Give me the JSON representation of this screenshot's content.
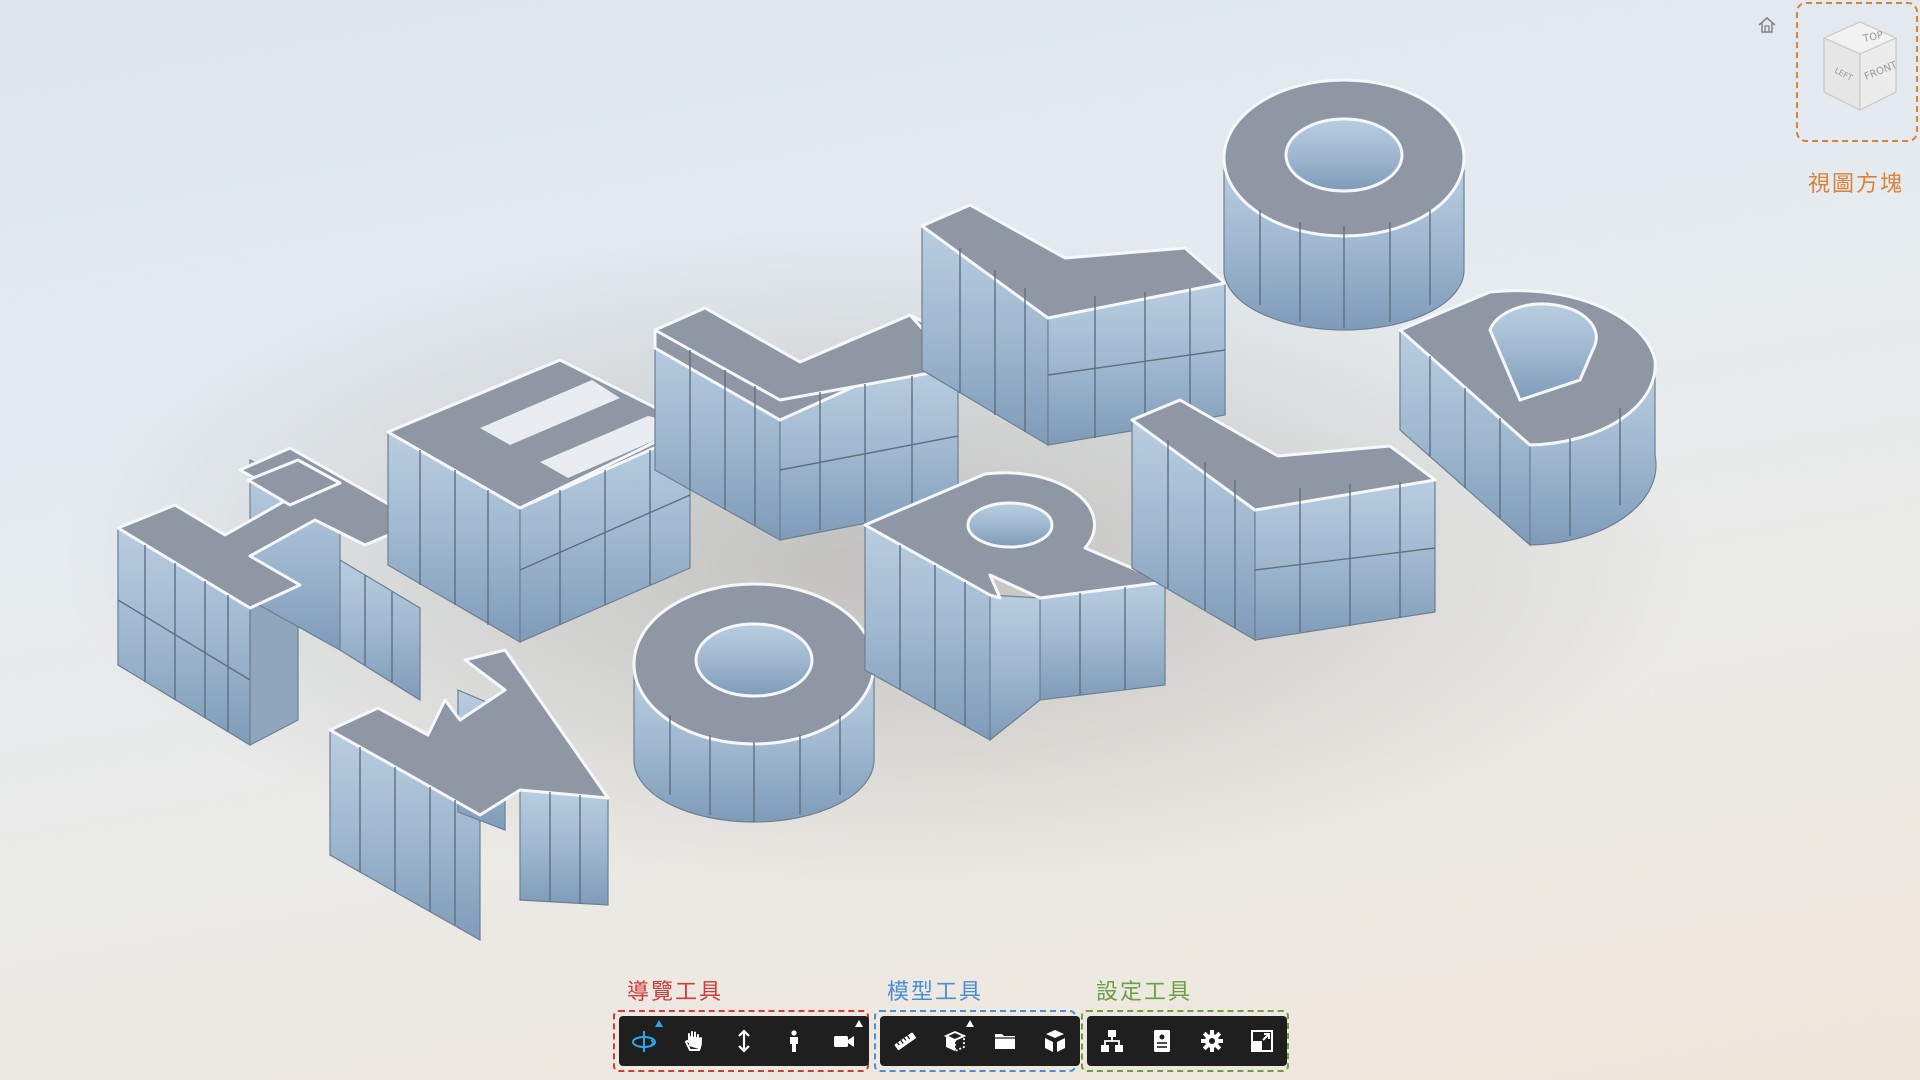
{
  "scene": {
    "model_text_top": "HELLO",
    "model_text_bottom": "WORLD"
  },
  "viewcube": {
    "label": "視圖方塊",
    "faces": {
      "top": "TOP",
      "front": "FRONT",
      "left": "LEFT"
    },
    "home_icon": "home-icon"
  },
  "toolbar": {
    "navigation": {
      "label": "導覽工具",
      "color": "#d33a3a",
      "tools": [
        {
          "name": "orbit",
          "icon": "orbit-icon",
          "active": true,
          "has_menu": true
        },
        {
          "name": "pan",
          "icon": "hand-icon",
          "active": false,
          "has_menu": false
        },
        {
          "name": "zoom",
          "icon": "zoom-arrows-icon",
          "active": false,
          "has_menu": false
        },
        {
          "name": "first-person",
          "icon": "person-icon",
          "active": false,
          "has_menu": false
        },
        {
          "name": "camera",
          "icon": "camera-icon",
          "active": false,
          "has_menu": true
        }
      ]
    },
    "model": {
      "label": "模型工具",
      "color": "#4a8fd6",
      "tools": [
        {
          "name": "measure",
          "icon": "ruler-icon",
          "active": false,
          "has_menu": false
        },
        {
          "name": "section",
          "icon": "section-box-icon",
          "active": false,
          "has_menu": true
        },
        {
          "name": "model-browser",
          "icon": "folder-icon",
          "active": false,
          "has_menu": false
        },
        {
          "name": "explode",
          "icon": "explode-cube-icon",
          "active": false,
          "has_menu": false
        }
      ]
    },
    "settings": {
      "label": "設定工具",
      "color": "#6aa044",
      "tools": [
        {
          "name": "structure",
          "icon": "hierarchy-icon",
          "active": false,
          "has_menu": false
        },
        {
          "name": "properties",
          "icon": "properties-icon",
          "active": false,
          "has_menu": false
        },
        {
          "name": "settings",
          "icon": "gear-icon",
          "active": false,
          "has_menu": false
        },
        {
          "name": "fullscreen",
          "icon": "fullscreen-icon",
          "active": false,
          "has_menu": false
        }
      ]
    }
  },
  "colors": {
    "accent": "#2aa8e8",
    "toolbar_bg": "#1f1f1f",
    "viewcube_annotation": "#d9823a"
  }
}
